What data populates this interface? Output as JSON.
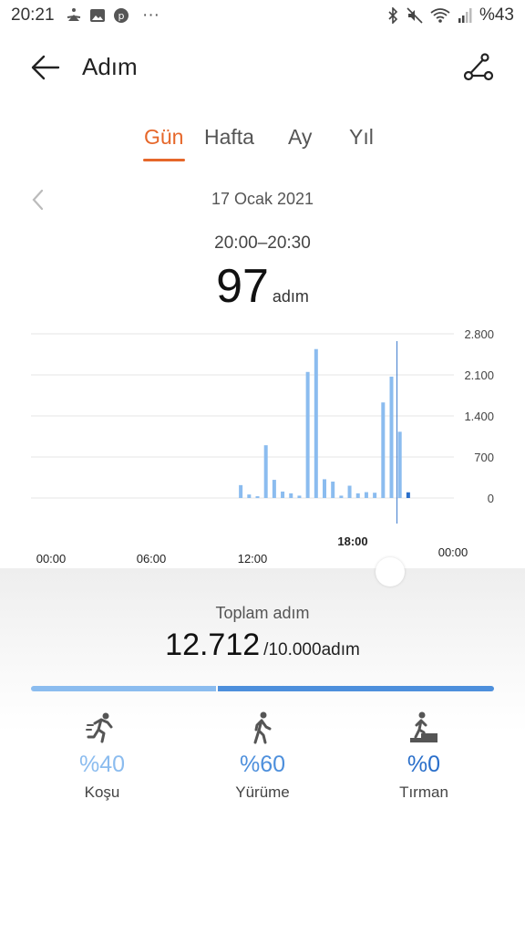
{
  "status_bar": {
    "time": "20:21",
    "battery": "%43",
    "more": "···"
  },
  "header": {
    "title": "Adım"
  },
  "tabs": [
    {
      "label": "Gün"
    },
    {
      "label": "Hafta"
    },
    {
      "label": "Ay"
    },
    {
      "label": "Yıl"
    }
  ],
  "date": "17 Ocak 2021",
  "selected": {
    "time_range": "20:00–20:30",
    "value": "97",
    "unit": "adım"
  },
  "chart_data": {
    "type": "bar",
    "y_ticks": [
      "2.800",
      "2.100",
      "1.400",
      "700",
      "0"
    ],
    "ylim": [
      0,
      2800
    ],
    "x_ticks": [
      "00:00",
      "06:00",
      "12:00",
      "18:00",
      "00:00"
    ],
    "x_range_hours": [
      0,
      24
    ],
    "selected_bar_time": 20.0,
    "bars": [
      {
        "t": 11.0,
        "v": 220
      },
      {
        "t": 11.5,
        "v": 60
      },
      {
        "t": 12.0,
        "v": 30
      },
      {
        "t": 12.5,
        "v": 900
      },
      {
        "t": 13.0,
        "v": 310
      },
      {
        "t": 13.5,
        "v": 110
      },
      {
        "t": 14.0,
        "v": 80
      },
      {
        "t": 14.5,
        "v": 40
      },
      {
        "t": 15.0,
        "v": 2150
      },
      {
        "t": 15.5,
        "v": 2540
      },
      {
        "t": 16.0,
        "v": 320
      },
      {
        "t": 16.5,
        "v": 280
      },
      {
        "t": 17.0,
        "v": 40
      },
      {
        "t": 17.5,
        "v": 210
      },
      {
        "t": 18.0,
        "v": 80
      },
      {
        "t": 18.5,
        "v": 100
      },
      {
        "t": 19.0,
        "v": 90
      },
      {
        "t": 19.5,
        "v": 1630
      },
      {
        "t": 20.0,
        "v": 2070
      },
      {
        "t": 20.5,
        "v": 1130
      },
      {
        "t": 21.0,
        "v": 97
      }
    ]
  },
  "summary": {
    "total_label": "Toplam adım",
    "total_value": "12.712",
    "goal": "/10.000adım",
    "split_fraction_run": 0.4
  },
  "stats": [
    {
      "icon": "running-icon",
      "percent": "%40",
      "label": "Koşu",
      "color": "#8bbcef"
    },
    {
      "icon": "walking-icon",
      "percent": "%60",
      "label": "Yürüme",
      "color": "#4d8fdc"
    },
    {
      "icon": "climbing-icon",
      "percent": "%0",
      "label": "Tırman",
      "color": "#2a6fca"
    }
  ],
  "colors": {
    "accent": "#e6672a",
    "bar": "#8bbcef",
    "bar_selected": "#2a6fca"
  }
}
